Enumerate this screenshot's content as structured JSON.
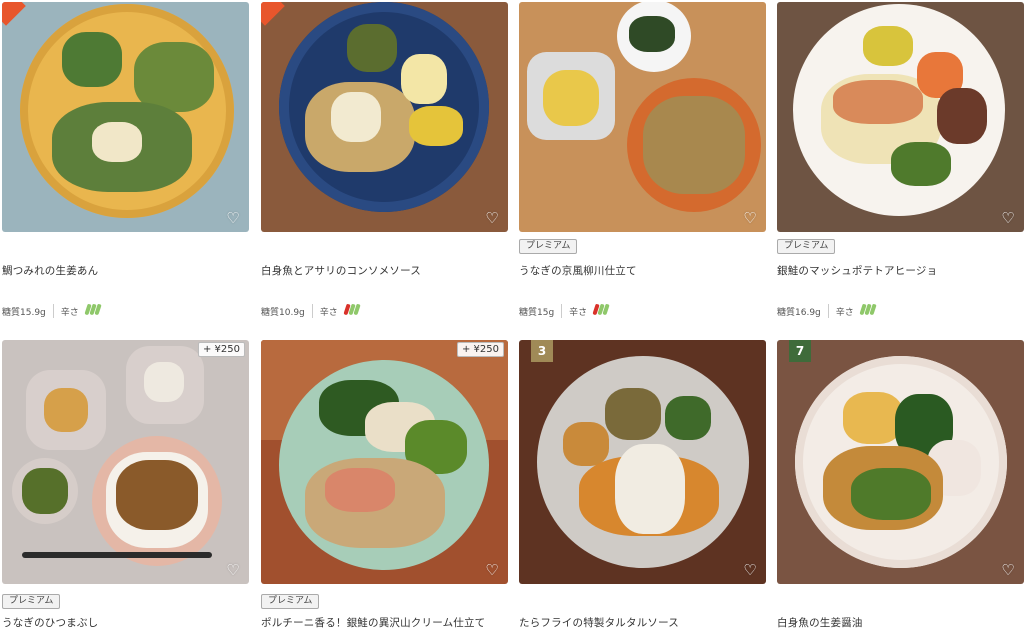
{
  "products": [
    {
      "name": "鯛つみれの生姜あん",
      "premium": false,
      "price_tag": "",
      "rank": "",
      "carbs_label": "糖質15.9g",
      "spicy_label": "辛さ",
      "spicy_level": 0
    },
    {
      "name": "白身魚とアサリのコンソメソース",
      "premium": false,
      "price_tag": "",
      "rank": "",
      "carbs_label": "糖質10.9g",
      "spicy_label": "辛さ",
      "spicy_level": 1
    },
    {
      "name": "うなぎの京風柳川仕立て",
      "premium": true,
      "price_tag": "",
      "rank": "",
      "carbs_label": "糖質15g",
      "spicy_label": "辛さ",
      "spicy_level": 1
    },
    {
      "name": "銀鮭のマッシュポテトアヒージョ",
      "premium": true,
      "price_tag": "",
      "rank": "",
      "carbs_label": "糖質16.9g",
      "spicy_label": "辛さ",
      "spicy_level": 0
    },
    {
      "name": "うなぎのひつまぶし",
      "premium": true,
      "price_tag": "+ ¥250",
      "rank": "",
      "carbs_label": "",
      "spicy_label": "",
      "spicy_level": 0
    },
    {
      "name": "ポルチーニ香る！銀鮭の異沢山クリーム仕立て",
      "premium": true,
      "price_tag": "+ ¥250",
      "rank": "",
      "carbs_label": "",
      "spicy_label": "",
      "spicy_level": 0
    },
    {
      "name": "たらフライの特製タルタルソース",
      "premium": false,
      "price_tag": "",
      "rank": "3",
      "carbs_label": "",
      "spicy_label": "",
      "spicy_level": 0
    },
    {
      "name": "白身魚の生姜醤油",
      "premium": false,
      "price_tag": "",
      "rank": "7",
      "carbs_label": "",
      "spicy_label": "",
      "spicy_level": 0
    }
  ],
  "premium_label": "プレミアム",
  "favorite_icon": "heart-outline-icon",
  "colors": {
    "rank_3": "#a08a57",
    "rank_7": "#3f6b3a",
    "spicy_active": "#d9322a",
    "spicy_inactive": "#8fc86a"
  }
}
